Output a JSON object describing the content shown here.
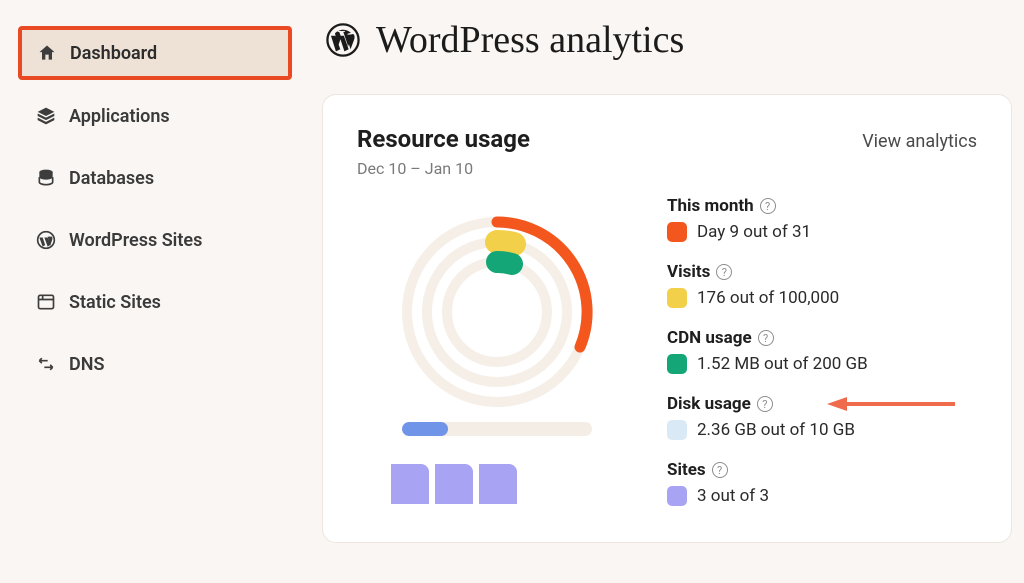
{
  "sidebar": {
    "items": [
      {
        "label": "Dashboard"
      },
      {
        "label": "Applications"
      },
      {
        "label": "Databases"
      },
      {
        "label": "WordPress Sites"
      },
      {
        "label": "Static Sites"
      },
      {
        "label": "DNS"
      }
    ]
  },
  "header": {
    "title": "WordPress analytics"
  },
  "card": {
    "title": "Resource usage",
    "view_link": "View analytics",
    "date_range": "Dec 10 – Jan 10"
  },
  "legend": {
    "this_month": {
      "title": "This month",
      "value": "Day 9 out of 31"
    },
    "visits": {
      "title": "Visits",
      "value": "176 out of 100,000"
    },
    "cdn": {
      "title": "CDN usage",
      "value": "1.52 MB out of 200 GB"
    },
    "disk": {
      "title": "Disk usage",
      "value": "2.36 GB out of 10 GB"
    },
    "sites": {
      "title": "Sites",
      "value": "3 out of 3"
    }
  },
  "chart_data": {
    "type": "radial-multi",
    "period": {
      "start": "Dec 10",
      "end": "Jan 10"
    },
    "series": [
      {
        "name": "This month",
        "value": 9,
        "max": 31,
        "color": "#f3571d"
      },
      {
        "name": "Visits",
        "value": 176,
        "max": 100000,
        "color": "#f2d04a"
      },
      {
        "name": "CDN usage",
        "value": 1.52,
        "max": 204800,
        "unit": "MB",
        "color": "#14a676"
      }
    ],
    "linear": {
      "name": "Disk usage",
      "value": 2.36,
      "max": 10,
      "unit": "GB",
      "color": "#6f94e8"
    },
    "sites": {
      "used": 3,
      "max": 3,
      "color": "#a8a3f3"
    }
  }
}
